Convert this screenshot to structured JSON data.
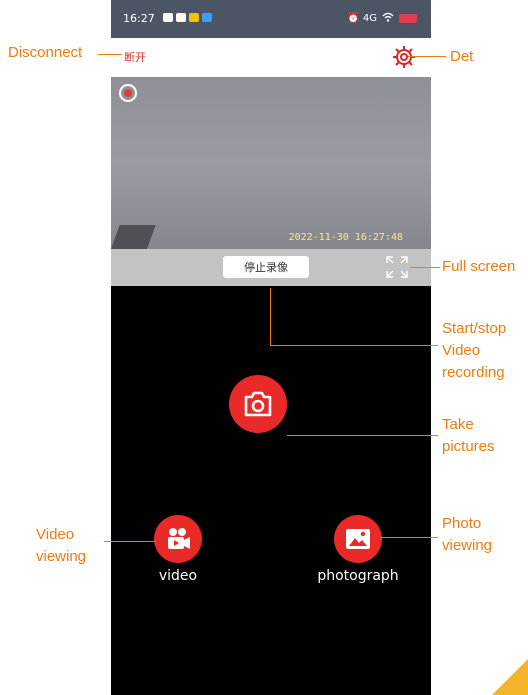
{
  "status_bar": {
    "time": "16:27",
    "right_text": "⏰ 4G"
  },
  "top_bar": {
    "disconnect_label": "断开"
  },
  "camera": {
    "timestamp": "2022-11-30  16:27:48"
  },
  "control_bar": {
    "stop_recording_label": "停止录像"
  },
  "buttons": {
    "video_label": "video",
    "photograph_label": "photograph"
  },
  "annotations": {
    "disconnect": "Disconnect",
    "det": "Det",
    "full_screen": "Full screen",
    "start_stop_line1": "Start/stop",
    "start_stop_line2": "Video",
    "start_stop_line3": "recording",
    "take_pictures_line1": "Take",
    "take_pictures_line2": "pictures",
    "video_viewing_line1": "Video",
    "video_viewing_line2": "viewing",
    "photo_viewing_line1": "Photo",
    "photo_viewing_line2": "viewing"
  },
  "colors": {
    "accent_red": "#ea2929",
    "annotation_orange": "#f07a11"
  }
}
